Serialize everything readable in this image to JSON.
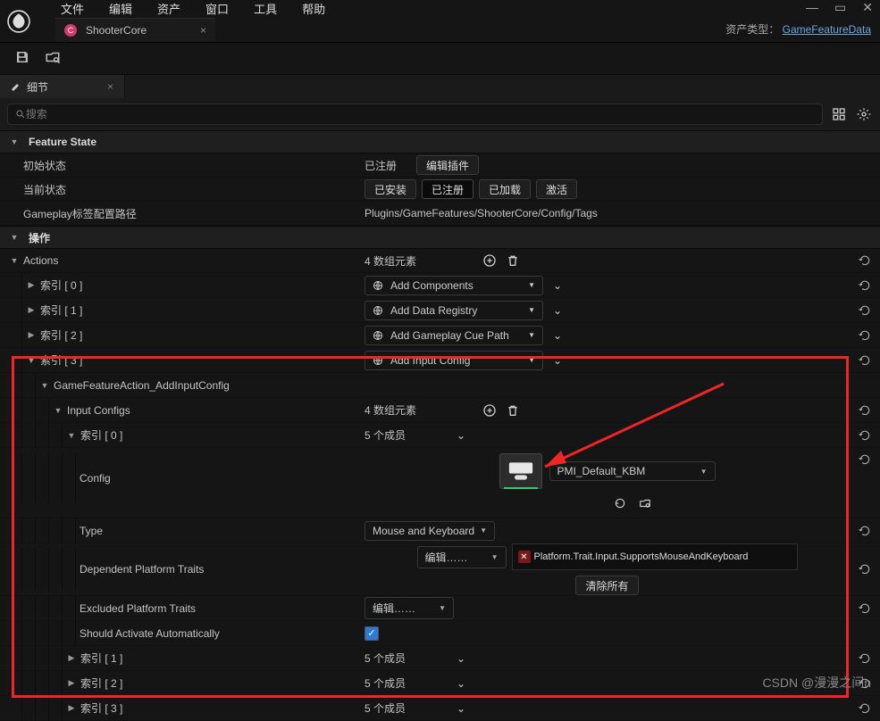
{
  "menu": [
    "文件",
    "编辑",
    "资产",
    "窗口",
    "工具",
    "帮助"
  ],
  "window": {
    "min": "—",
    "max": "▭",
    "close": "✕"
  },
  "tab": {
    "name": "ShooterCore",
    "close": "×"
  },
  "assetTypeLabel": "资产类型：",
  "assetTypeLink": "GameFeatureData",
  "panelTab": {
    "title": "细节",
    "close": "×"
  },
  "search": {
    "placeholder": "搜索"
  },
  "sections": {
    "featureState": "Feature State",
    "actions": "操作"
  },
  "featureState": {
    "initStateLabel": "初始状态",
    "registeredText": "已注册",
    "editPluginBtn": "编辑插件",
    "currentStateLabel": "当前状态",
    "pills": [
      "已安装",
      "已注册",
      "已加载",
      "激活"
    ],
    "selectedPill": 1,
    "tagPathLabel": "Gameplay标签配置路径",
    "tagPathValue": "Plugins/GameFeatures/ShooterCore/Config/Tags"
  },
  "actions": {
    "label": "Actions",
    "countText": "4 数组元素",
    "items": [
      {
        "index": "索引 [ 0 ]",
        "value": "Add Components"
      },
      {
        "index": "索引 [ 1 ]",
        "value": "Add Data Registry"
      },
      {
        "index": "索引 [ 2 ]",
        "value": "Add Gameplay Cue Path"
      },
      {
        "index": "索引 [ 3 ]",
        "value": "Add Input Config"
      }
    ]
  },
  "inputConfig": {
    "className": "GameFeatureAction_AddInputConfig",
    "inputConfigsLabel": "Input Configs",
    "inputConfigsCount": "4 数组元素",
    "idx0": "索引 [ 0 ]",
    "membersText": "5 个成员",
    "configLabel": "Config",
    "configValue": "PMI_Default_KBM",
    "typeLabel": "Type",
    "typeValue": "Mouse and Keyboard",
    "depLabel": "Dependent Platform Traits",
    "editBtn": "编辑……",
    "clearAllBtn": "清除所有",
    "traitTag": "Platform.Trait.Input.SupportsMouseAndKeyboard",
    "exclLabel": "Excluded Platform Traits",
    "autoLabel": "Should Activate Automatically",
    "restIdx": [
      "索引 [ 1 ]",
      "索引 [ 2 ]",
      "索引 [ 3 ]"
    ]
  },
  "watermark": "CSDN @漫漫之间n"
}
